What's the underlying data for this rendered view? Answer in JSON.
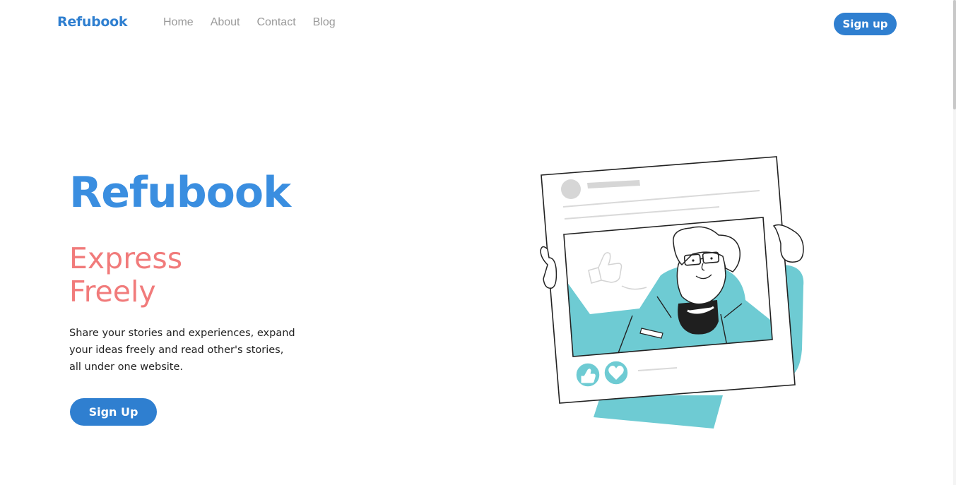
{
  "navbar": {
    "brand": "Refubook",
    "links": [
      "Home",
      "About",
      "Contact",
      "Blog"
    ],
    "signup_label": "Sign up"
  },
  "hero": {
    "title": "Refubook",
    "tagline": "Express Freely",
    "description": "Share your stories and experiences, expand your ideas freely and read other's stories, all under one website.",
    "signup_label": "Sign Up"
  },
  "colors": {
    "primary": "#2f7fd0",
    "title": "#3a8ee0",
    "accent": "#f17b7b",
    "illustration_teal": "#6ecbd3"
  },
  "icons": [
    "thumbs-up-icon",
    "heart-icon"
  ]
}
